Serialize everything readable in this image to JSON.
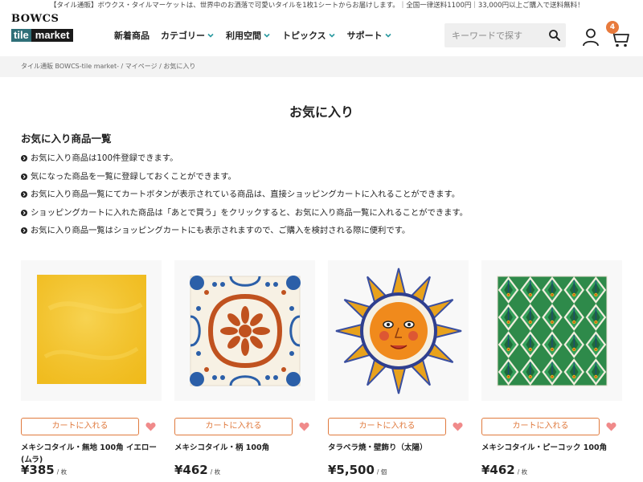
{
  "announcement": "【タイル通販】ボウクス・タイルマーケットは、世界中のお洒落で可愛いタイルを1枚1シートからお届けします。｜全国一律送料1100円｜33,000円以上ご購入で送料無料！",
  "logo": {
    "top_text": "BOWCS",
    "word1": "tile",
    "word2": "market"
  },
  "nav": [
    {
      "label": "新着商品",
      "has_dropdown": false
    },
    {
      "label": "カテゴリー",
      "has_dropdown": true
    },
    {
      "label": "利用空間",
      "has_dropdown": true
    },
    {
      "label": "トピックス",
      "has_dropdown": true
    },
    {
      "label": "サポート",
      "has_dropdown": true
    }
  ],
  "search": {
    "placeholder": "キーワードで探す",
    "value": ""
  },
  "cart": {
    "count": "4"
  },
  "breadcrumb": [
    {
      "label": "タイル通販 BOWCS-tile market-"
    },
    {
      "label": "マイページ"
    },
    {
      "label": "お気に入り"
    }
  ],
  "page_title": "お気に入り",
  "section_title": "お気に入り商品一覧",
  "notes": [
    "お気に入り商品は100件登録できます。",
    "気になった商品を一覧に登録しておくことができます。",
    "お気に入り商品一覧にてカートボタンが表示されている商品は、直接ショッピングカートに入れることができます。",
    "ショッピングカートに入れた商品は「あとで買う」をクリックすると、お気に入り商品一覧に入れることができます。",
    "お気に入り商品一覧はショッピングカートにも表示されますので、ご購入を検討される際に便利です。"
  ],
  "products": [
    {
      "name": "メキシコタイル・無地 100角 イエロー(ムラ)",
      "price": "¥385",
      "unit": "/ 枚",
      "button": "カートに入れる",
      "image": "yellow-tile"
    },
    {
      "name": "メキシコタイル・柄 100角",
      "price": "¥462",
      "unit": "/ 枚",
      "button": "カートに入れる",
      "image": "flower-tile"
    },
    {
      "name": "タラベラ焼・壁飾り（太陽）",
      "price": "¥5,500",
      "unit": "/ 個",
      "button": "カートに入れる",
      "image": "sun-ornament"
    },
    {
      "name": "メキシコタイル・ピーコック 100角",
      "price": "¥462",
      "unit": "/ 枚",
      "button": "カートに入れる",
      "image": "peacock-tile"
    }
  ],
  "colors": {
    "accent": "#e07a3e",
    "badge": "#e87a3c",
    "heart": "#f08a8a",
    "nav_chevron": "#2a9aa0",
    "logo_tile": "#2f6f78"
  }
}
